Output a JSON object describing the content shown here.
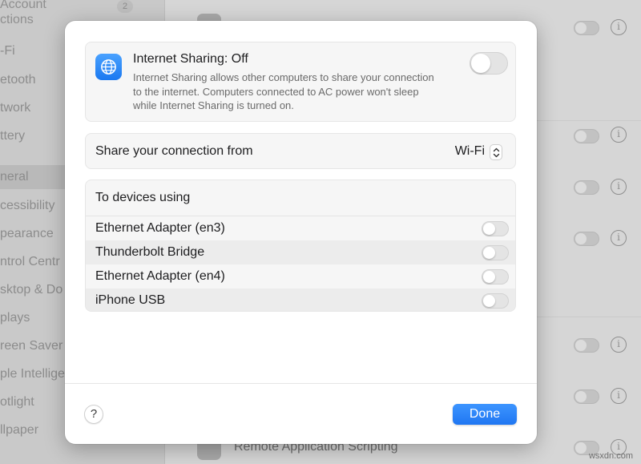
{
  "background": {
    "sidebar_top_text": "Account\nctions",
    "sidebar_badge": "2",
    "sidebar_items": [
      {
        "label": "-Fi"
      },
      {
        "label": "etooth"
      },
      {
        "label": "twork"
      },
      {
        "label": "ttery"
      },
      {
        "label": "neral",
        "selected": true
      },
      {
        "label": "cessibility"
      },
      {
        "label": "pearance"
      },
      {
        "label": "ntrol Centr"
      },
      {
        "label": "sktop & Do"
      },
      {
        "label": "plays"
      },
      {
        "label": "reen Saver"
      },
      {
        "label": "ple Intellige"
      },
      {
        "label": "otlight"
      },
      {
        "label": "llpaper"
      }
    ],
    "bottom_item_label": "Remote Application Scripting"
  },
  "sheet": {
    "internet_sharing": {
      "title": "Internet Sharing: Off",
      "description": "Internet Sharing allows other computers to share your connection to the internet. Computers connected to AC power won't sleep while Internet Sharing is turned on.",
      "enabled": false,
      "icon": "globe-icon"
    },
    "share_from": {
      "label": "Share your connection from",
      "value": "Wi-Fi"
    },
    "devices": {
      "header": "To devices using",
      "items": [
        {
          "label": "Ethernet Adapter (en3)",
          "enabled": false
        },
        {
          "label": "Thunderbolt Bridge",
          "enabled": false
        },
        {
          "label": "Ethernet Adapter (en4)",
          "enabled": false
        },
        {
          "label": "iPhone USB",
          "enabled": false
        }
      ]
    },
    "help_label": "?",
    "done_label": "Done"
  },
  "watermark": "wsxdn.com",
  "colors": {
    "accent": "#1f76f2",
    "icon_blue": "#2a86f5"
  }
}
